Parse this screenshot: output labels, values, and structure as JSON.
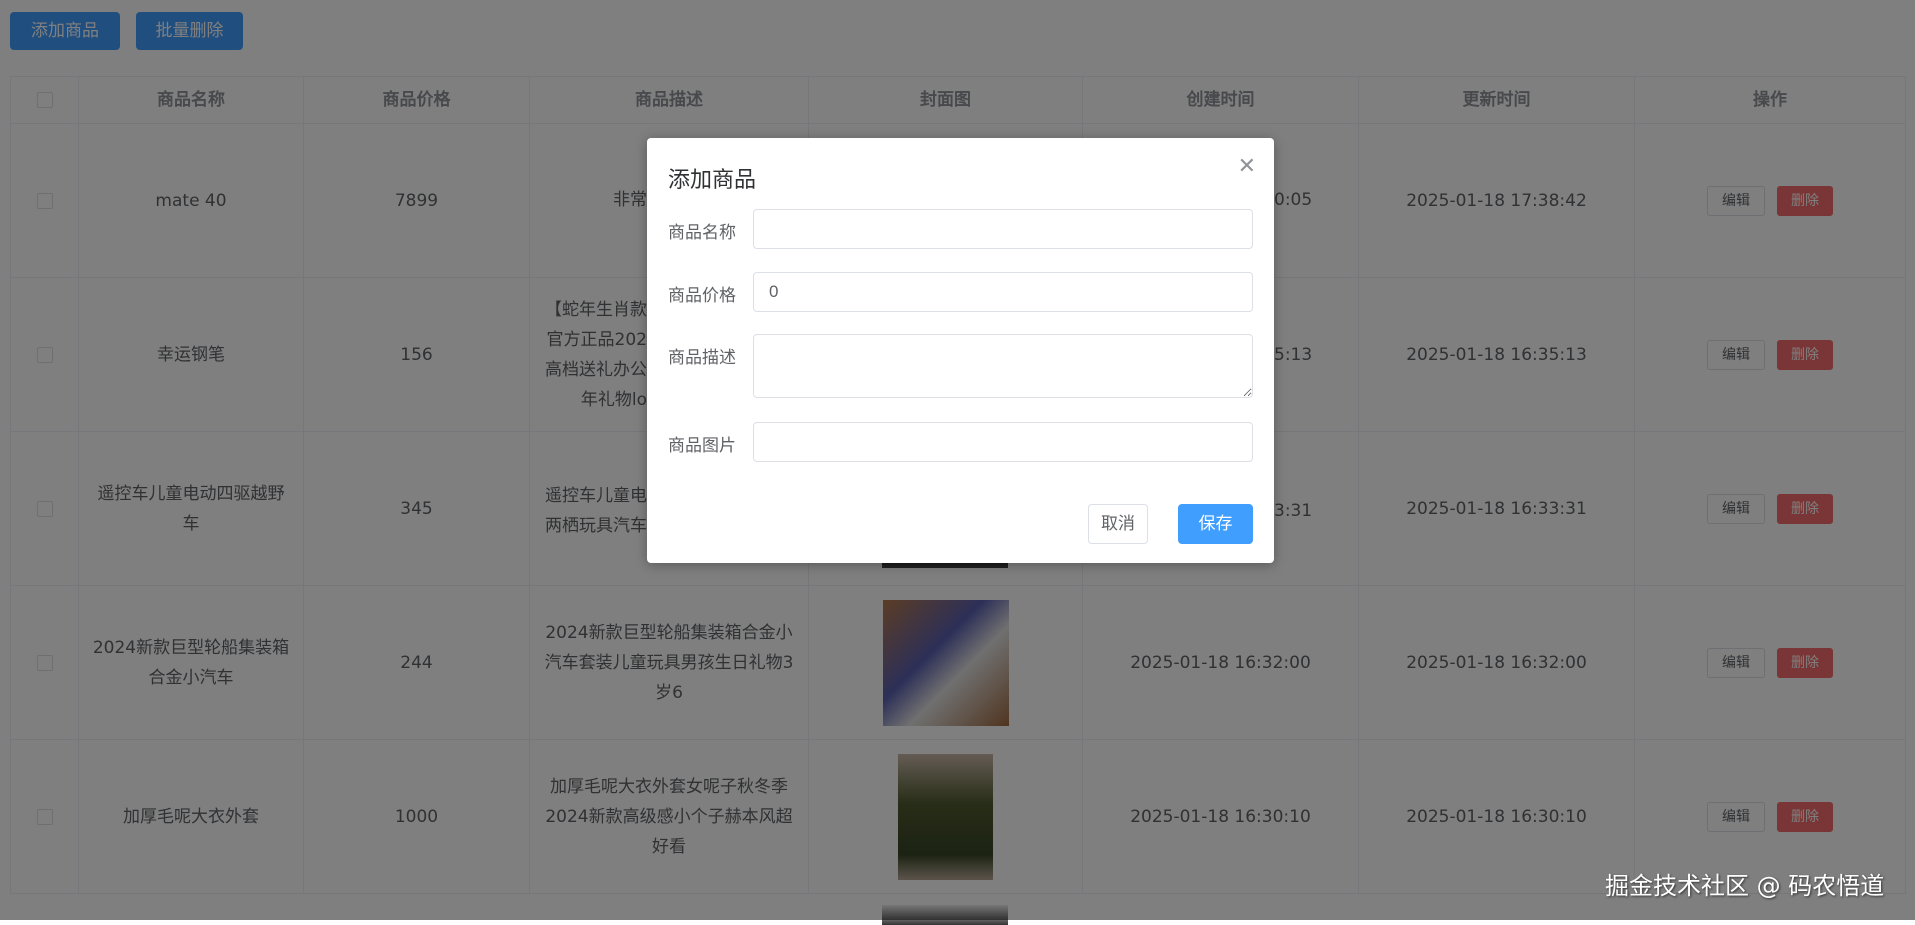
{
  "toolbar": {
    "add_label": "添加商品",
    "batch_delete_label": "批量删除"
  },
  "table": {
    "headers": [
      "商品名称",
      "商品价格",
      "商品描述",
      "封面图",
      "创建时间",
      "更新时间",
      "操作"
    ],
    "edit_label": "编辑",
    "delete_label": "删除",
    "rows": [
      {
        "name": "mate 40",
        "price": "7899",
        "desc_visible": [
          "非常"
        ],
        "created_visible": "0:05",
        "updated": "2025-01-18 17:38:42"
      },
      {
        "name": "幸运钢笔",
        "price": "156",
        "desc_visible": [
          "【蛇年生肖款",
          "官方正品202",
          "高档送礼办公",
          "年礼物lo"
        ],
        "created_visible": "5:13",
        "updated": "2025-01-18 16:35:13"
      },
      {
        "name": "遥控车儿童电动四驱越野车",
        "price": "345",
        "desc_visible": [
          "遥控车儿童电",
          "两栖玩具汽车"
        ],
        "created_visible": "3:31",
        "updated": "2025-01-18 16:33:31"
      },
      {
        "name": "2024新款巨型轮船集装箱合金小汽车",
        "price": "244",
        "desc": "2024新款巨型轮船集装箱合金小汽车套装儿童玩具男孩生日礼物3岁6",
        "created": "2025-01-18 16:32:00",
        "updated": "2025-01-18 16:32:00"
      },
      {
        "name": "加厚毛呢大衣外套",
        "price": "1000",
        "desc": "加厚毛呢大衣外套女呢子秋冬季2024新款高级感小个子赫本风超好看",
        "created": "2025-01-18 16:30:10",
        "updated": "2025-01-18 16:30:10"
      }
    ]
  },
  "modal": {
    "title": "添加商品",
    "fields": [
      {
        "label": "商品名称",
        "value": ""
      },
      {
        "label": "商品价格",
        "value": "0"
      },
      {
        "label": "商品描述",
        "value": ""
      },
      {
        "label": "商品图片",
        "value": ""
      }
    ],
    "cancel_label": "取消",
    "save_label": "保存"
  },
  "watermark": "掘金技术社区 @ 码农悟道",
  "colors": {
    "primary": "#409eff",
    "danger": "#f56c6c"
  }
}
